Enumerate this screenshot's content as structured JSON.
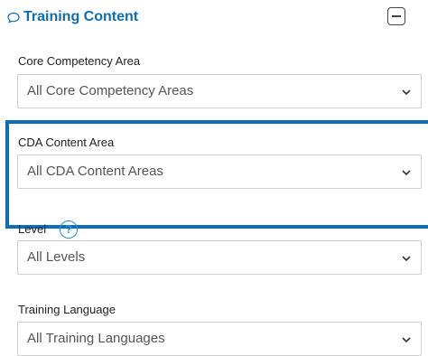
{
  "section": {
    "title": "Training Content",
    "icon": "chat-bubble-icon",
    "collapse_icon": "minus-square-icon",
    "accent_color": "#0b6fb8"
  },
  "fields": [
    {
      "label": "Core Competency Area",
      "value": "All Core Competency Areas",
      "highlighted": false
    },
    {
      "label": "CDA Content Area",
      "value": "All CDA Content Areas",
      "highlighted": true
    },
    {
      "label": "Level",
      "value": "All Levels",
      "help_icon": "help-circle-icon",
      "help_glyph": "?"
    },
    {
      "label": "Training Language",
      "value": "All Training Languages"
    }
  ],
  "colors": {
    "highlight_border": "#0b6fb8",
    "help_icon": "#2a8bd8"
  }
}
